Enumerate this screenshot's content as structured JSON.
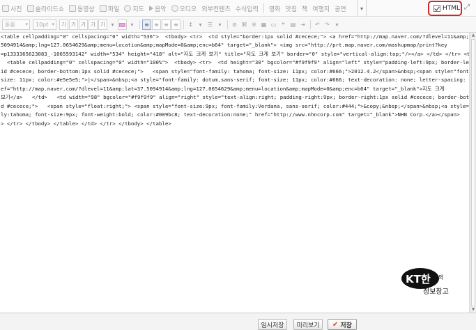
{
  "toolbar_top": {
    "items": [
      {
        "label": "사진",
        "icon": "photo-icon"
      },
      {
        "label": "슬라이드쇼",
        "icon": "slideshow-icon"
      },
      {
        "label": "동영상",
        "icon": "video-icon"
      },
      {
        "label": "파일",
        "icon": "file-icon"
      },
      {
        "label": "지도",
        "icon": "map-icon"
      },
      {
        "label": "음악",
        "icon": "music-icon"
      },
      {
        "label": "오디오",
        "icon": "audio-icon"
      },
      {
        "label": "외부컨텐츠",
        "icon": ""
      },
      {
        "label": "수식입력",
        "icon": ""
      }
    ],
    "items_right": [
      "영화",
      "맛집",
      "책",
      "여행지",
      "공연"
    ],
    "html_toggle": {
      "label": "HTML",
      "checked": true
    }
  },
  "toolbar_format": {
    "font_select": "돋움",
    "size_select": "10pt",
    "bold": "가",
    "italic": "가",
    "underline": "가",
    "strike": "가",
    "text_color": "가",
    "align_buttons": [
      "left",
      "center",
      "right",
      "justify"
    ],
    "accent_color": "#f0a0e0"
  },
  "editor": {
    "lines": [
      "<table cellpadding=\"0\" cellspacing=\"0\" width=\"536\">  <tbody> <tr>  <td style=\"border:1px solid #cecece;\"> <a href=\"http://map.naver.com/?dlevel=11&amp;lat=37.",
      "5094914&amp;lng=127.0654629&amp;menu=location&amp;mapMode=0&amp;enc=b64\" target=\"_blank\"> <img src=\"http://prt.map.naver.com/mashupmap/print?key",
      "=p1333365623083_-1065593142\" width=\"534\" height=\"418\" alt=\"지도 크게 보기\" title=\"지도 크게 보기\" border=\"0\" style=\"vertical-align:top;\"/></a> </td> </tr> <tr> <td>",
      "  <table cellpadding=\"0\" cellspacing=\"0\" width=\"100%\">  <tbody> <tr>  <td height=\"30\" bgcolor=\"#f9f9f9\" align=\"left\" style=\"padding-left:9px; border-left:1px sol",
      "id #cecece; border-bottom:1px solid #cecece;\">   <span style=\"font-family: tahoma; font-size: 11px; color:#666;\">2012.4.2</span>&nbsp;<span style=\"font-",
      "size: 11px; color:#e5e5e5;\">|</span>&nbsp;<a style=\"font-family: dotum,sans-serif; font-size: 11px; color:#666; text-decoration: none; letter-spacing: -1px;\" hr",
      "ef=\"http://map.naver.com/?dlevel=11&amp;lat=37.5094914&amp;lng=127.0654629&amp;menu=location&amp;mapMode=0&amp;enc=b64\" target=\"_blank\">지도 크게",
      "보기</a>   </td>   <td width=\"98\" bgcolor=\"#f9f9f9\" align=\"right\" style=\"text-align:right; padding-right:9px; border-right:1px solid #cecece; border-bottom:1px soli",
      "d #cecece;\">   <span style=\"float:right;\"> <span style=\"font-size:9px; font-family:Verdana, sans-serif; color:#444;\">&copy;&nbsp;</span>&nbsp;<a style=\"font-fami",
      "ly:tahoma; font-size:9px; font-weight:bold; color:#009bc8; text-decoration:none;\" href=\"http://www.nhncorp.com\" target=\"_blank\">NHN Corp.</a></span>   </td",
      "> </tr> </tbody> </table> </td> </tr> </tbody> </table>"
    ]
  },
  "watermark": {
    "line1": "KT한",
    "line2": "정보창고",
    "suffix": "의"
  },
  "bottom_bar": {
    "temp_save": "임시저장",
    "preview": "미리보기",
    "save": "저장"
  }
}
